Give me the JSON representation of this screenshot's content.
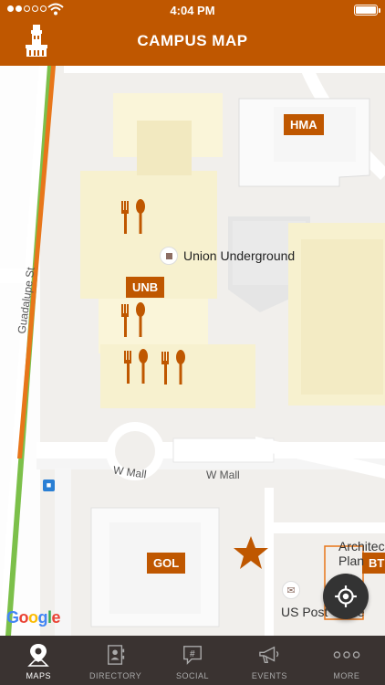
{
  "status_bar": {
    "time": "4:04 PM"
  },
  "header": {
    "title": "CAMPUS MAP",
    "logo_icon": "ut-tower-icon"
  },
  "map": {
    "buildings": [
      {
        "code": "HMA"
      },
      {
        "code": "UNB"
      },
      {
        "code": "GOL"
      },
      {
        "code": "BT"
      }
    ],
    "poi_union": "Union Underground",
    "poi_post": "US Post Office",
    "architecture_text": [
      "Architec",
      "Plan"
    ],
    "streets": {
      "guadalupe": "Guadalupe St",
      "w_mall_1": "W Mall",
      "w_mall_2": "W Mall"
    },
    "attribution": "Google"
  },
  "tabs": [
    {
      "label": "MAPS",
      "icon": "map-pin-icon",
      "active": true
    },
    {
      "label": "DIRECTORY",
      "icon": "directory-icon",
      "active": false
    },
    {
      "label": "SOCIAL",
      "icon": "hashtag-icon",
      "active": false
    },
    {
      "label": "EVENTS",
      "icon": "megaphone-icon",
      "active": false
    },
    {
      "label": "MORE",
      "icon": "more-icon",
      "active": false
    }
  ],
  "colors": {
    "brand": "#bf5700",
    "tab_bar": "#3a3331"
  }
}
